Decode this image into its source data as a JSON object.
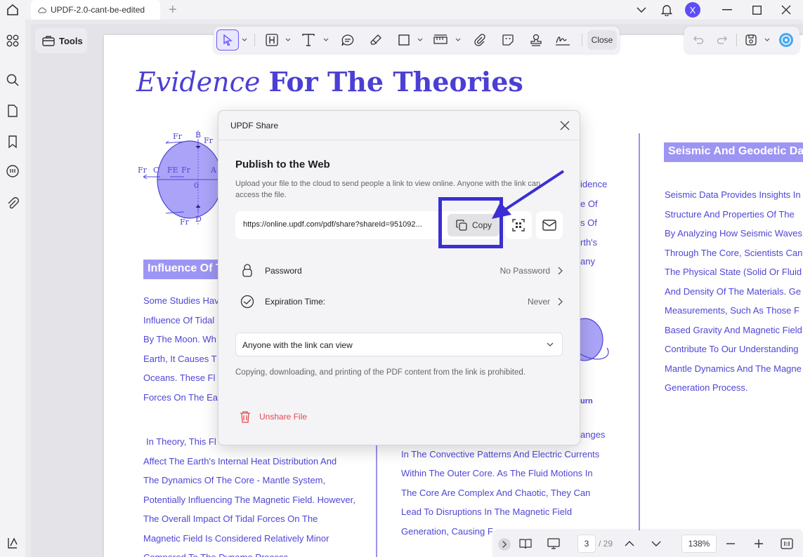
{
  "titlebar": {
    "tab_label": "UPDF-2.0-cant-be-edited",
    "avatar_letter": "X"
  },
  "toolbar": {
    "tools_label": "Tools",
    "close_label": "Close"
  },
  "document": {
    "title_italic": "Evidence",
    "title_bold": "For The Theories",
    "heading_left": "Influence Of Tidal Forces",
    "heading_right": "Seismic And Geodetic Data",
    "left_col_top": [
      "Some Studies Have",
      "Influence Of Tidal",
      "By The Moon. Wh",
      "Earth, It Causes T",
      "Oceans. These Fl",
      "Forces On The Ea"
    ],
    "left_col_bottom": [
      "In Theory, This Fl",
      "Affect The Earth's Internal Heat Distribution And",
      "The Dynamics Of The Core - Mantle System,",
      "Potentially Influencing The Magnetic Field. However,",
      "The Overall Impact Of Tidal Forces On The",
      "Magnetic Field Is Considered Relatively Minor",
      "Compared To The Dynamo Process."
    ],
    "mid_col_top": [
      "idence",
      "e Of",
      "s Of",
      "rth's",
      "any"
    ],
    "mid_col_turn": "urn",
    "mid_col_bottom": [
      "anges",
      "In The Convective Patterns And Electric Currents",
      "Within The Outer Core. As The Fluid Motions In",
      "The Core Are Complex And Chaotic, They Can",
      "Lead To Disruptions In The Magnetic Field",
      "Generation, Causing F"
    ],
    "right_col": [
      "Seismic Data Provides Insights In",
      "Structure And Properties Of The",
      "By Analyzing How Seismic Waves",
      "Through The Core, Scientists Can",
      "The Physical State (Solid Or Fluid",
      "And Density Of The Materials. Ge",
      "Measurements, Such As Those F",
      "Based Gravity And Magnetic Field",
      "Contribute To Our Understanding",
      "Mantle Dynamics And The Magne",
      "Generation Process."
    ],
    "diagram_labels": [
      "Fr",
      "B",
      "Fr",
      "Fr",
      "C",
      "FE",
      "Fr",
      "0",
      "A",
      "Fr",
      "D"
    ]
  },
  "modal": {
    "title": "UPDF Share",
    "heading": "Publish to the Web",
    "description": "Upload your file to the cloud to send people a link to view online. Anyone with the link can access the file.",
    "link": "https://online.updf.com/pdf/share?shareId=951092...",
    "copy_label": "Copy",
    "password_label": "Password",
    "password_value": "No Password",
    "expiration_label": "Expiration Time:",
    "expiration_value": "Never",
    "access_option": "Anyone with the link can view",
    "note": "Copying, downloading, and printing of the PDF content from the link is prohibited.",
    "unshare_label": "Unshare File"
  },
  "bottombar": {
    "current_page": "3",
    "total_pages": "/ 29",
    "zoom": "138%"
  },
  "colors": {
    "accent": "#5c4df5",
    "doc_text": "#5046d6",
    "highlight": "#3b2fd1",
    "danger": "#e8484b"
  }
}
